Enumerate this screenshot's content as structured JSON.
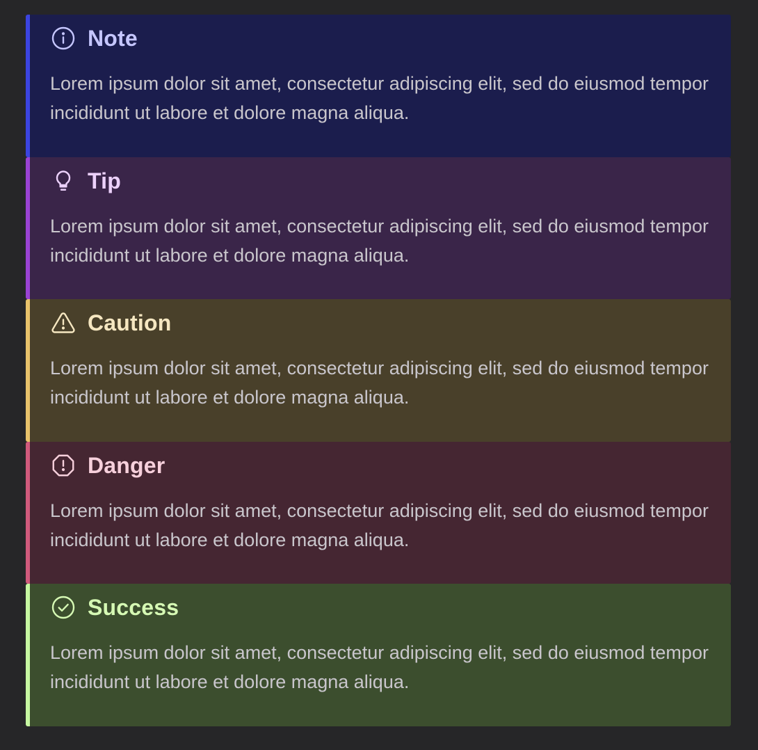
{
  "callouts": [
    {
      "id": "note",
      "title": "Note",
      "icon": "info-circle-icon",
      "text": "Lorem ipsum dolor sit amet, consectetur adipiscing elit, sed do eiusmod tempor incididunt ut labore et dolore magna aliqua.",
      "colors": {
        "background": "#1b1d4d",
        "border": "#3b44e0",
        "title": "#c5c6ff"
      }
    },
    {
      "id": "tip",
      "title": "Tip",
      "icon": "lightbulb-icon",
      "text": "Lorem ipsum dolor sit amet, consectetur adipiscing elit, sed do eiusmod tempor incididunt ut labore et dolore magna aliqua.",
      "colors": {
        "background": "#3a2549",
        "border": "#9a43d4",
        "title": "#ecd1fb"
      }
    },
    {
      "id": "caution",
      "title": "Caution",
      "icon": "warning-triangle-icon",
      "text": "Lorem ipsum dolor sit amet, consectetur adipiscing elit, sed do eiusmod tempor incididunt ut labore et dolore magna aliqua.",
      "colors": {
        "background": "#49402a",
        "border": "#e8c26b",
        "title": "#f6e7c1"
      }
    },
    {
      "id": "danger",
      "title": "Danger",
      "icon": "alert-octagon-icon",
      "text": "Lorem ipsum dolor sit amet, consectetur adipiscing elit, sed do eiusmod tempor incididunt ut labore et dolore magna aliqua.",
      "colors": {
        "background": "#452632",
        "border": "#d05a7c",
        "title": "#f7d0dc"
      }
    },
    {
      "id": "success",
      "title": "Success",
      "icon": "check-circle-icon",
      "text": "Lorem ipsum dolor sit amet, consectetur adipiscing elit, sed do eiusmod tempor incididunt ut labore et dolore magna aliqua.",
      "colors": {
        "background": "#3c4e2e",
        "border": "#c6f7a1",
        "title": "#d6f9b4"
      }
    }
  ]
}
